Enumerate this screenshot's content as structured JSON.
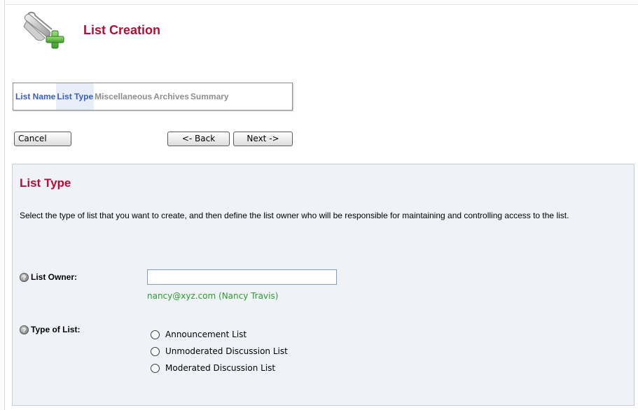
{
  "header": {
    "title": "List Creation",
    "icon": "scroll-add-icon"
  },
  "steps": [
    {
      "label": "List Name",
      "state": "done"
    },
    {
      "label": "List Type",
      "state": "active"
    },
    {
      "label": "Miscellaneous",
      "state": "pending"
    },
    {
      "label": "Archives",
      "state": "pending"
    },
    {
      "label": "Summary",
      "state": "pending"
    }
  ],
  "buttons": {
    "cancel": "Cancel",
    "back": "<- Back",
    "next": "Next ->"
  },
  "panel": {
    "title": "List Type",
    "description": "Select the type of list that you want to create, and then define the list owner who will be responsible for maintaining and controlling access to the list.",
    "owner": {
      "label": "List Owner:",
      "value": "",
      "hint": "nancy@xyz.com (Nancy Travis)"
    },
    "type": {
      "label": "Type of List:",
      "options": [
        "Announcement List",
        "Unmoderated Discussion List",
        "Moderated Discussion List"
      ]
    }
  },
  "colors": {
    "title": "#b50d35",
    "step_active": "#3a5ebc",
    "step_pending": "#8e8e8e",
    "hint": "#2e9a2e",
    "panel_bg": "#eff2f7"
  }
}
